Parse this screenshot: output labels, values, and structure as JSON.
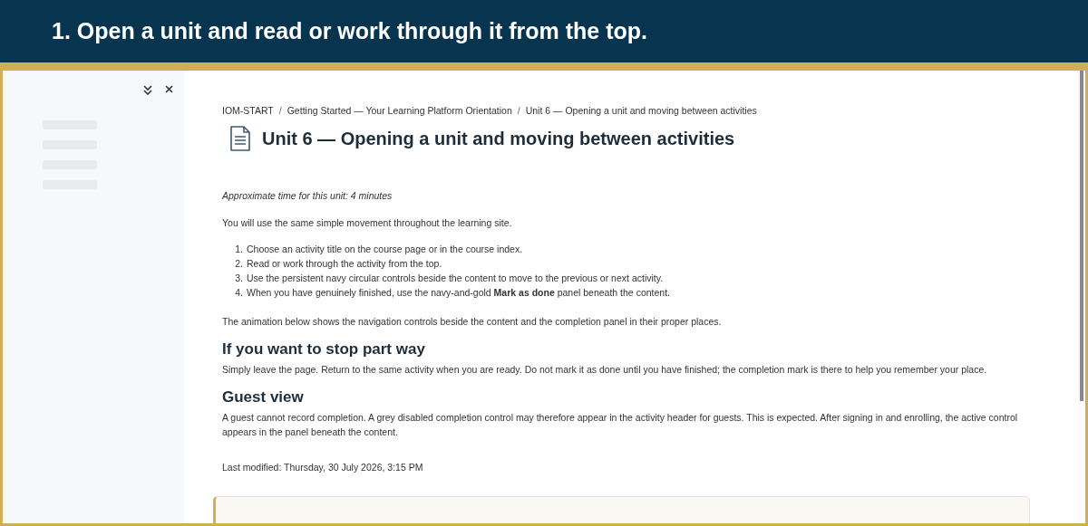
{
  "banner": {
    "title": "1. Open a unit and read or work through it from the top."
  },
  "breadcrumb_separator": "/",
  "breadcrumb": [
    "IOM-START",
    "Getting Started — Your Learning Platform Orientation",
    "Unit 6 — Opening a unit and moving between activities"
  ],
  "page_title": "Unit 6 — Opening a unit and moving between activities",
  "time_note": "Approximate time for this unit: 4 minutes",
  "intro": "You will use the same simple movement throughout the learning site.",
  "steps": [
    {
      "number": "1.",
      "text": "Choose an activity title on the course page or in the course index."
    },
    {
      "number": "2.",
      "text": "Read or work through the activity from the top."
    },
    {
      "number": "3.",
      "text": "Use the persistent navy circular controls beside the content to move to the previous or next activity."
    },
    {
      "number": "4.",
      "text": "When you have genuinely finished, use the navy-and-gold **Mark as done** panel beneath the content."
    }
  ],
  "after_steps": "The animation below shows the navigation controls beside the content and the completion panel in their proper places.",
  "sections": [
    {
      "heading": "If you want to stop part way",
      "text": "Simply leave the page. Return to the same activity when you are ready. Do not mark it as done until you have finished; the completion mark is there to help you remember your place."
    },
    {
      "heading": "Guest view",
      "text": "A guest cannot record completion. A grey disabled completion control may therefore appear in the activity header for guests. This is expected. After signing in and enrolling, the active control appears in the panel beneath the content."
    }
  ],
  "last_modified": "Last modified: Thursday, 30 July 2026, 3:15 PM"
}
